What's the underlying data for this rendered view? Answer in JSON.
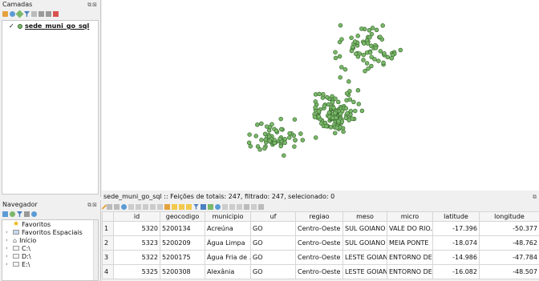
{
  "layers_panel": {
    "title": "Camadas",
    "layers": [
      {
        "name": "sede_muni_go_sql",
        "checked": true,
        "symbol_color": "#7ab86a"
      }
    ]
  },
  "browser_panel": {
    "title": "Navegador",
    "items": [
      {
        "label": "Favoritos",
        "icon": "star-icon"
      },
      {
        "label": "Favoritos Espaciais",
        "icon": "spatial-bookmark-icon"
      },
      {
        "label": "Início",
        "icon": "home-icon"
      },
      {
        "label": "C:\\",
        "icon": "drive-icon"
      },
      {
        "label": "D:\\",
        "icon": "drive-icon"
      },
      {
        "label": "E:\\",
        "icon": "drive-icon"
      }
    ]
  },
  "map": {
    "point_fill": "#7ab86a",
    "point_stroke": "#3b6b2f"
  },
  "attribute_table": {
    "title": "sede_muni_go_sql :: Feições de totais: 247, filtrado: 247, selecionado: 0",
    "columns": [
      "id",
      "geocodigo",
      "municipio",
      "uf",
      "regiao",
      "meso",
      "micro",
      "latitude",
      "longitude"
    ],
    "rows": [
      {
        "row": "1",
        "id": "5320",
        "geocodigo": "5200134",
        "municipio": "Acreúna",
        "uf": "GO",
        "regiao": "Centro-Oeste",
        "meso": "SUL GOIANO",
        "micro": "VALE DO RIO...",
        "latitude": "-17.396",
        "longitude": "-50.377"
      },
      {
        "row": "2",
        "id": "5323",
        "geocodigo": "5200209",
        "municipio": "Água Limpa",
        "uf": "GO",
        "regiao": "Centro-Oeste",
        "meso": "SUL GOIANO",
        "micro": "MEIA PONTE",
        "latitude": "-18.074",
        "longitude": "-48.762"
      },
      {
        "row": "3",
        "id": "5322",
        "geocodigo": "5200175",
        "municipio": "Água Fria de ...",
        "uf": "GO",
        "regiao": "Centro-Oeste",
        "meso": "LESTE GOIANO",
        "micro": "ENTORNO DE...",
        "latitude": "-14.986",
        "longitude": "-47.784"
      },
      {
        "row": "4",
        "id": "5325",
        "geocodigo": "5200308",
        "municipio": "Alexânia",
        "uf": "GO",
        "regiao": "Centro-Oeste",
        "meso": "LESTE GOIANO",
        "micro": "ENTORNO DE...",
        "latitude": "-16.082",
        "longitude": "-48.507"
      }
    ]
  }
}
